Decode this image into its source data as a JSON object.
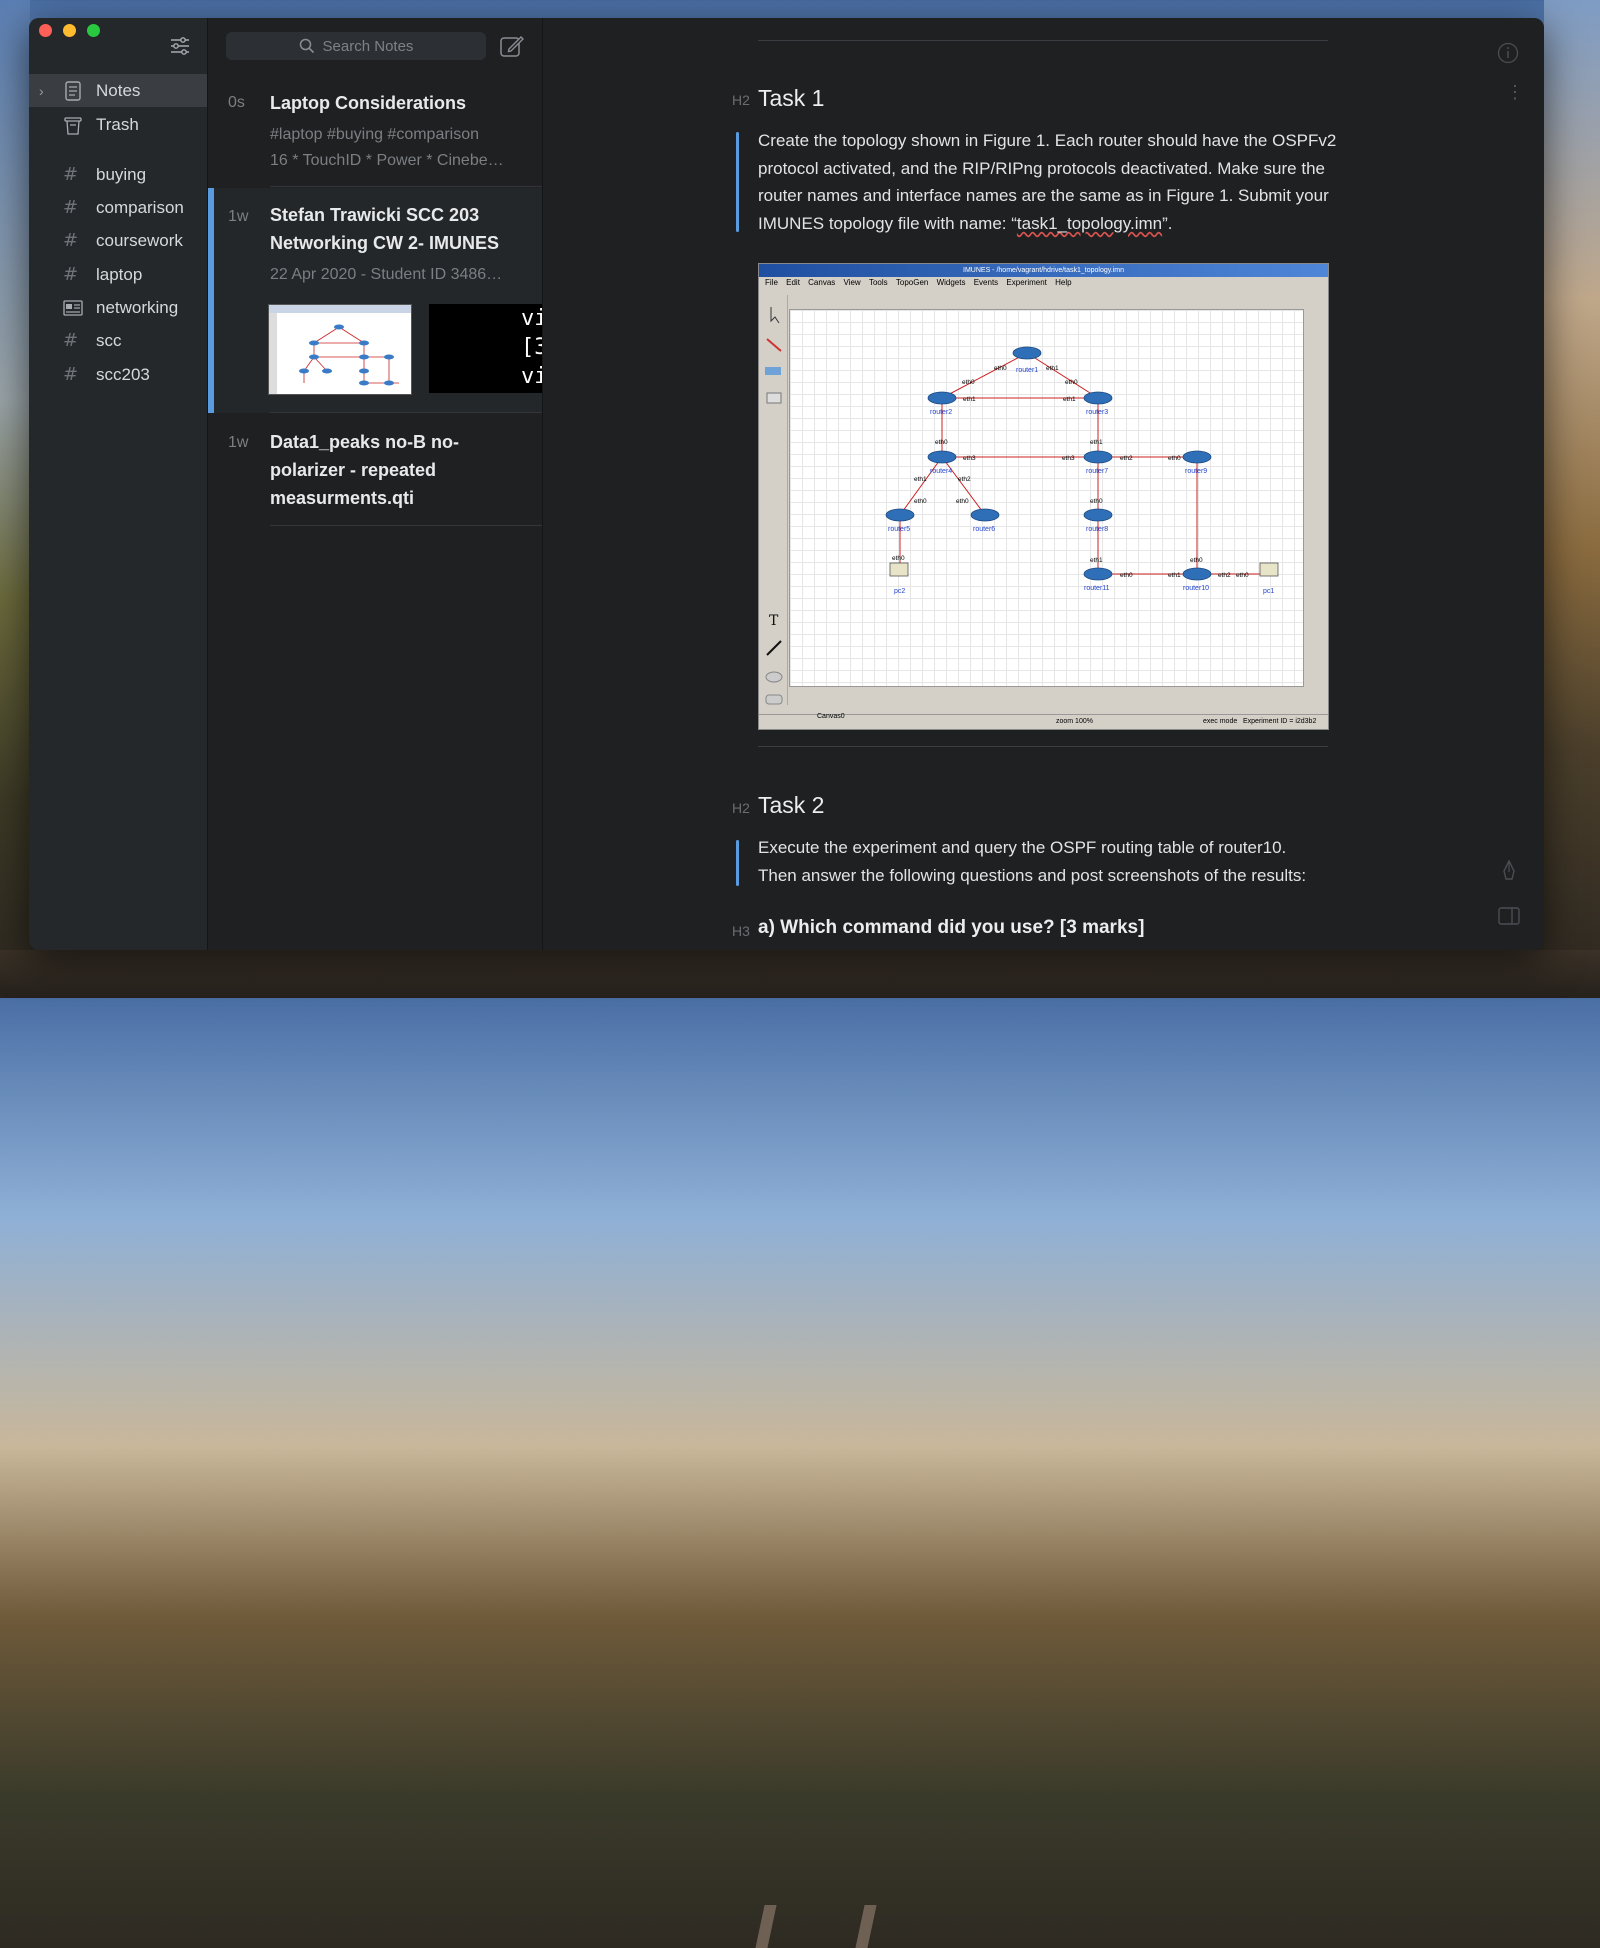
{
  "sidebar": {
    "items": [
      {
        "label": "Notes",
        "icon": "notes-icon"
      },
      {
        "label": "Trash",
        "icon": "trash-icon"
      }
    ],
    "tags": [
      {
        "label": "buying",
        "icon": "hash-icon"
      },
      {
        "label": "comparison",
        "icon": "hash-icon"
      },
      {
        "label": "coursework",
        "icon": "hash-icon"
      },
      {
        "label": "laptop",
        "icon": "hash-icon"
      },
      {
        "label": "networking",
        "icon": "newspaper-icon"
      },
      {
        "label": "scc",
        "icon": "hash-icon"
      },
      {
        "label": "scc203",
        "icon": "hash-icon"
      }
    ]
  },
  "search": {
    "placeholder": "Search Notes"
  },
  "notes": [
    {
      "age": "0s",
      "title": "Laptop Considerations",
      "sub1": "#laptop #buying #comparison",
      "sub2": "16 * TouchID * Power * Cinebe…"
    },
    {
      "age": "1w",
      "title": "Stefan Trawicki SCC 203 Networking CW 2- IMUNES",
      "sub1": "22 Apr 2020 - Student ID 3486…",
      "thumb_text": [
        "vi",
        "[3",
        "vi"
      ]
    },
    {
      "age": "1w",
      "title": "Data1_peaks no-B  no-polarizer - repeated measurments.qti"
    }
  ],
  "editor": {
    "h2_marker": "H2",
    "h3_marker": "H3",
    "task1_heading": "Task 1",
    "task1_text_before": "Create the topology shown in Figure 1. Each router should have the OSPFv2 protocol activated, and the RIP/RIPng protocols deactivated. Make sure the router names and interface names are the same as in Figure 1. Submit your IMUNES topology file with name: “",
    "task1_filename": "task1_topology.imn",
    "task1_text_after": "”.",
    "task2_heading": "Task 2",
    "task2_text": "Execute the experiment and query the OSPF routing table of router10. Then answer the following questions and post screenshots of the results:",
    "question_a": "a) Which command did you use? [3 marks]"
  },
  "figure": {
    "window_title": "IMUNES - /home/vagrant/hdrive/task1_topology.imn",
    "menu": [
      "File",
      "Edit",
      "Canvas",
      "View",
      "Tools",
      "TopoGen",
      "Widgets",
      "Events",
      "Experiment",
      "Help"
    ],
    "canvas_tab": "Canvas0",
    "zoom": "zoom 100%",
    "mode": "exec mode",
    "experiment_id": "Experiment ID = i2d3b2",
    "nodes": {
      "router1": "router1",
      "router2": "router2",
      "router3": "router3",
      "router4": "router4",
      "router5": "router5",
      "router6": "router6",
      "router7": "router7",
      "router8": "router8",
      "router9": "router9",
      "router10": "router10",
      "router11": "router11",
      "pc1": "pc1",
      "pc2": "pc2"
    }
  }
}
